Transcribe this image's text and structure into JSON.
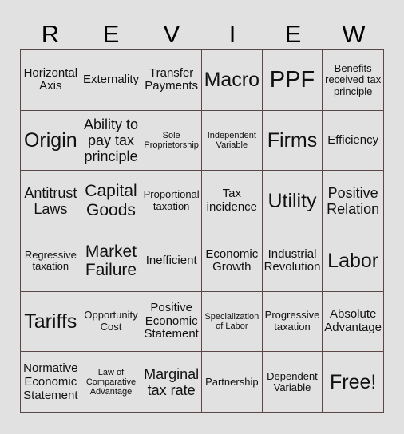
{
  "title_letters": [
    "R",
    "E",
    "V",
    "I",
    "E",
    "W"
  ],
  "cells": [
    {
      "text": "Horizontal Axis",
      "size": "s-md"
    },
    {
      "text": "Externality",
      "size": "s-md"
    },
    {
      "text": "Transfer Payments",
      "size": "s-md"
    },
    {
      "text": "Macro",
      "size": "s-xxl"
    },
    {
      "text": "PPF",
      "size": "s-xxxl"
    },
    {
      "text": "Benefits received tax principle",
      "size": "s-sm"
    },
    {
      "text": "Origin",
      "size": "s-xxl"
    },
    {
      "text": "Ability to pay tax principle",
      "size": "s-lg"
    },
    {
      "text": "Sole Proprietorship",
      "size": "s-xs"
    },
    {
      "text": "Independent Variable",
      "size": "s-xs"
    },
    {
      "text": "Firms",
      "size": "s-xxl"
    },
    {
      "text": "Efficiency",
      "size": "s-md"
    },
    {
      "text": "Antitrust Laws",
      "size": "s-lg"
    },
    {
      "text": "Capital Goods",
      "size": "s-xl"
    },
    {
      "text": "Proportional taxation",
      "size": "s-sm"
    },
    {
      "text": "Tax incidence",
      "size": "s-md"
    },
    {
      "text": "Utility",
      "size": "s-xxl"
    },
    {
      "text": "Positive Relation",
      "size": "s-lg"
    },
    {
      "text": "Regressive taxation",
      "size": "s-sm"
    },
    {
      "text": "Market Failure",
      "size": "s-xl"
    },
    {
      "text": "Inefficient",
      "size": "s-md"
    },
    {
      "text": "Economic Growth",
      "size": "s-md"
    },
    {
      "text": "Industrial Revolution",
      "size": "s-md"
    },
    {
      "text": "Labor",
      "size": "s-xxl"
    },
    {
      "text": "Tariffs",
      "size": "s-xxl"
    },
    {
      "text": "Opportunity Cost",
      "size": "s-sm"
    },
    {
      "text": "Positive Economic Statement",
      "size": "s-md"
    },
    {
      "text": "Specialization of Labor",
      "size": "s-xs"
    },
    {
      "text": "Progressive taxation",
      "size": "s-sm"
    },
    {
      "text": "Absolute Advantage",
      "size": "s-md"
    },
    {
      "text": "Normative Economic Statement",
      "size": "s-md"
    },
    {
      "text": "Law of Comparative Advantage",
      "size": "s-xs"
    },
    {
      "text": "Marginal tax rate",
      "size": "s-lg"
    },
    {
      "text": "Partnership",
      "size": "s-sm"
    },
    {
      "text": "Dependent Variable",
      "size": "s-sm"
    },
    {
      "text": "Free!",
      "size": "s-xxl"
    }
  ]
}
